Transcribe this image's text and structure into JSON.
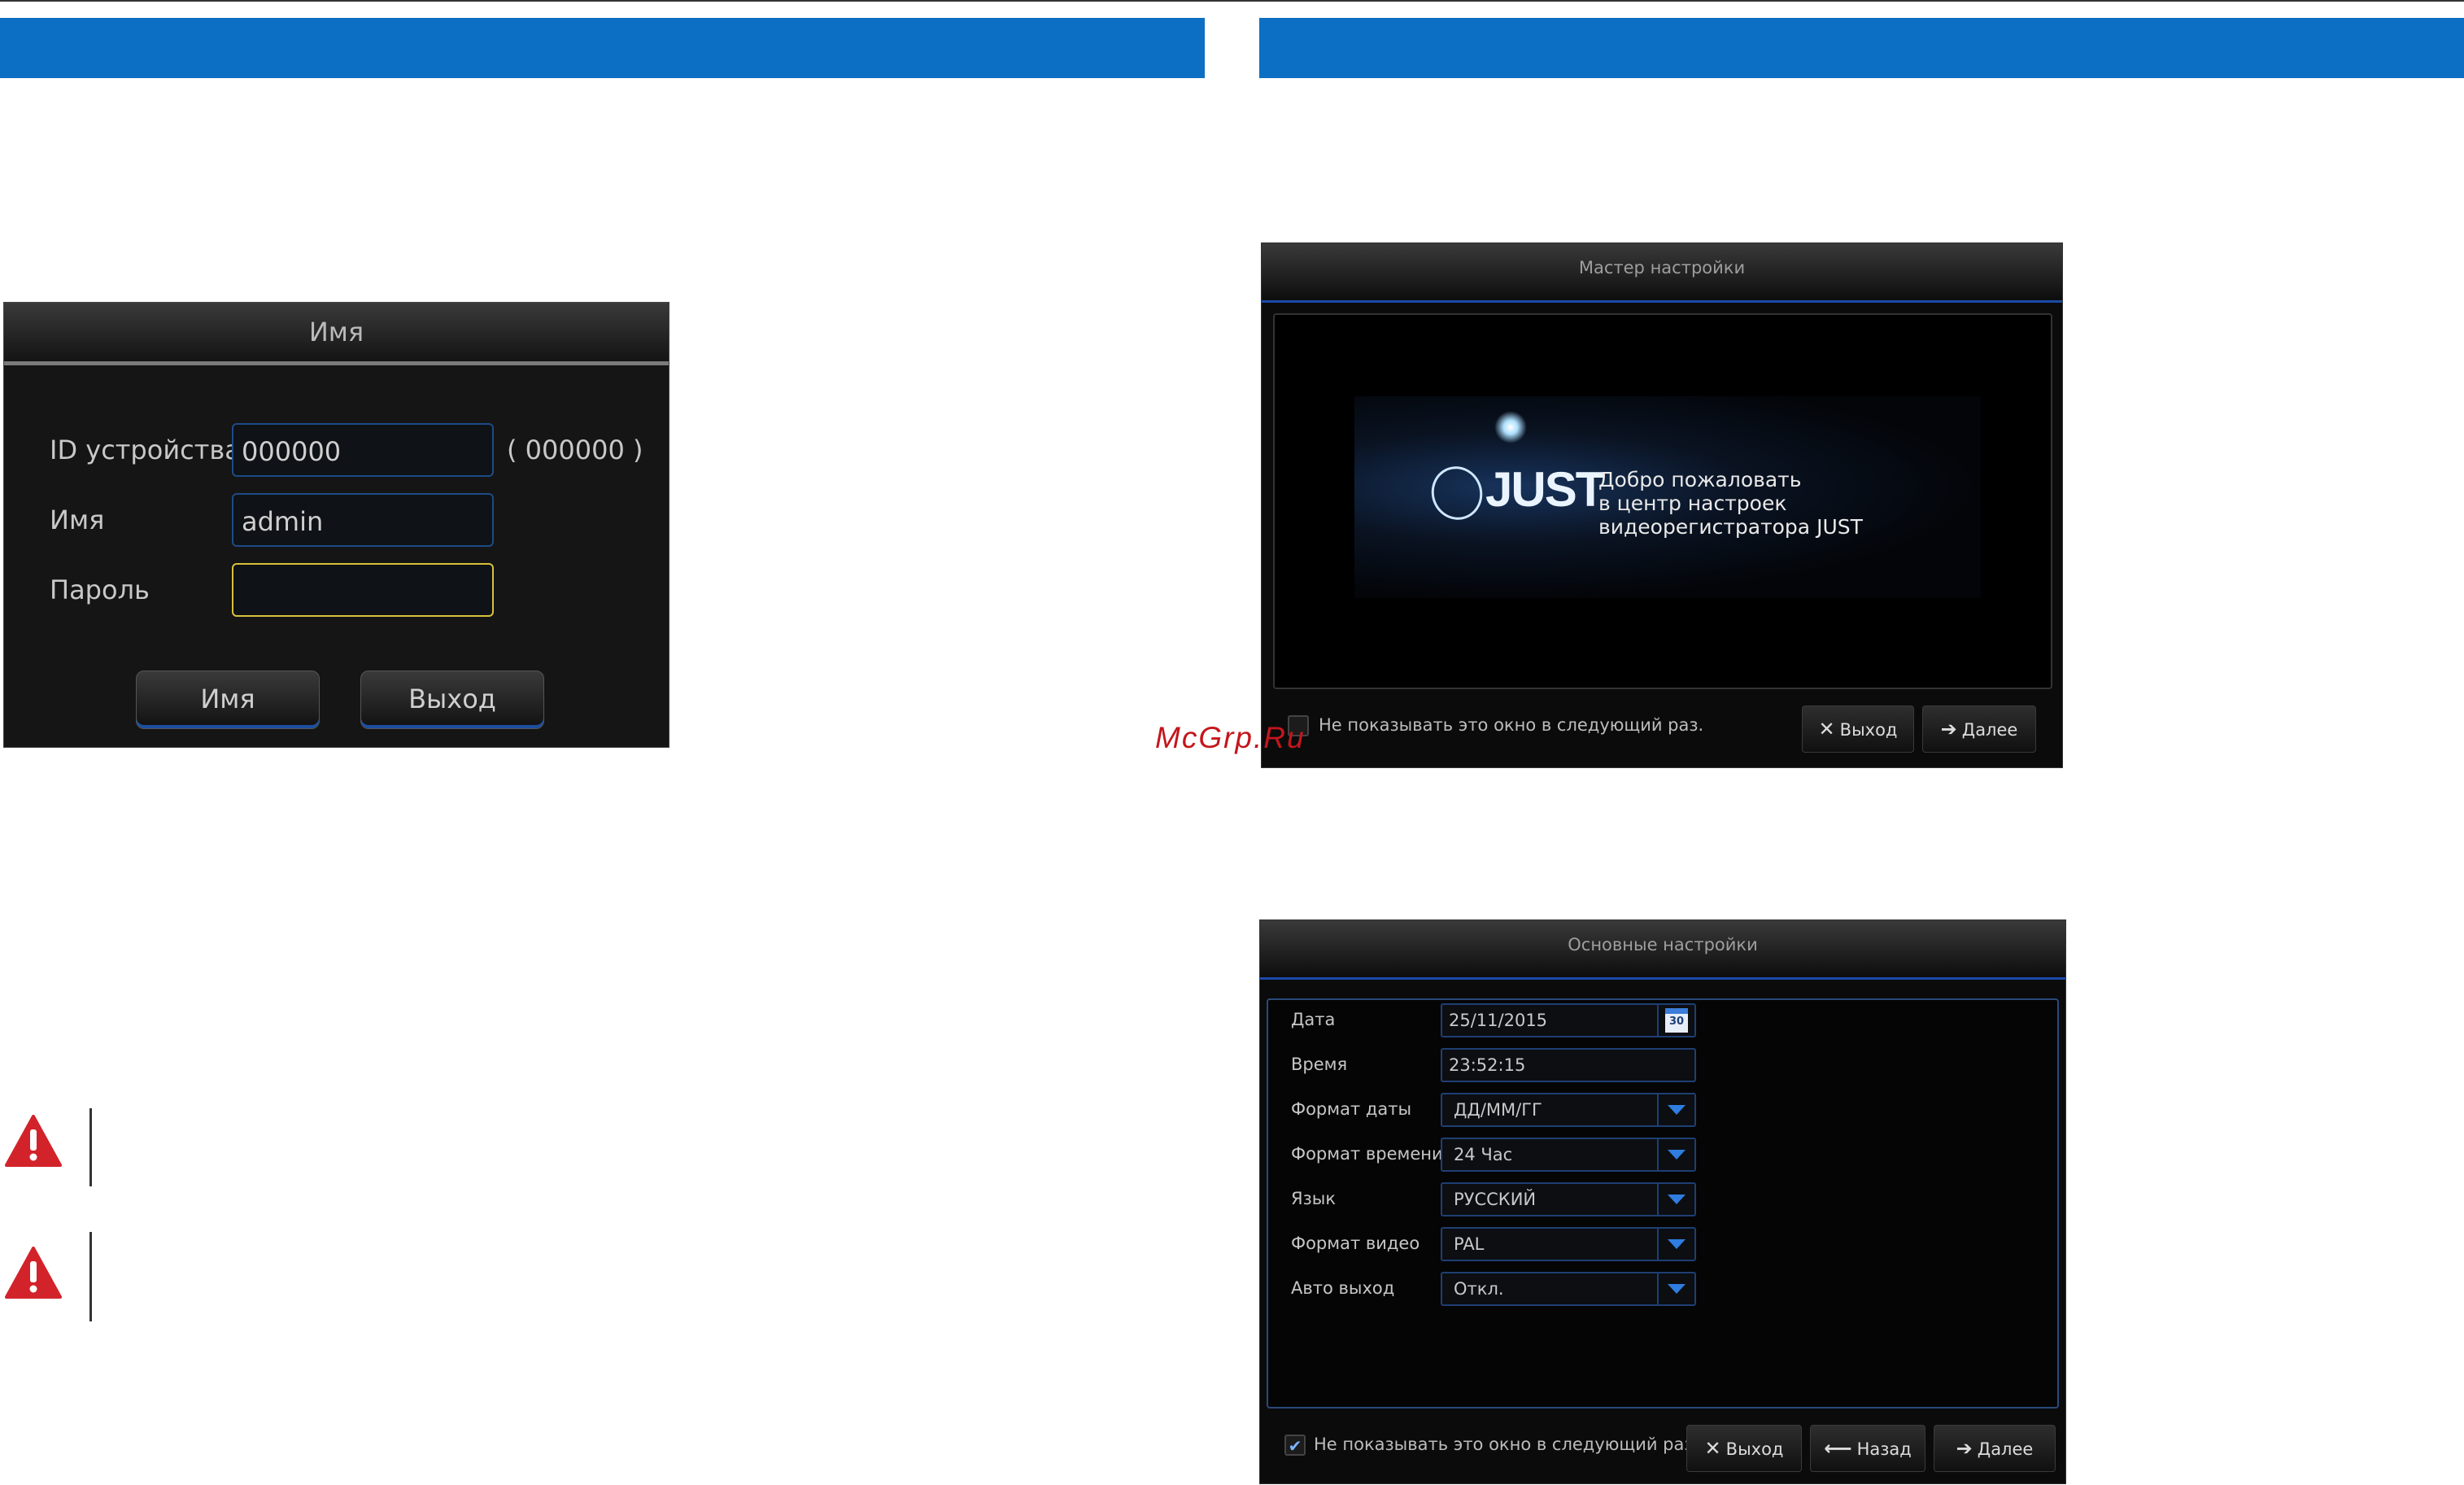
{
  "login": {
    "title": "Имя",
    "device_id_label": "ID устройства",
    "device_id_value": "000000",
    "device_id_hint": "( 000000 )",
    "name_label": "Имя",
    "name_value": "admin",
    "password_label": "Пароль",
    "password_value": "",
    "login_button": "Имя",
    "exit_button": "Выход"
  },
  "wizard": {
    "title": "Мастер настройки",
    "logo_text": "JUST",
    "welcome_line1": "Добро пожаловать",
    "welcome_line2": "в центр настроек",
    "welcome_line3": "видеорегистратора JUST",
    "dont_show_label": "Не показывать это окно в следующий раз.",
    "dont_show_checked": false,
    "exit_button": "Выход",
    "next_button": "Далее"
  },
  "settings": {
    "title": "Основные настройки",
    "rows": [
      {
        "label": "Дата",
        "value": "25/11/2015",
        "control": "calendar"
      },
      {
        "label": "Время",
        "value": "23:52:15",
        "control": "text"
      },
      {
        "label": "Формат даты",
        "value": "ДД/ММ/ГГ",
        "control": "dropdown"
      },
      {
        "label": "Формат времени",
        "value": "24 Час",
        "control": "dropdown"
      },
      {
        "label": "Язык",
        "value": "РУССКИЙ",
        "control": "dropdown"
      },
      {
        "label": "Формат видео",
        "value": "PAL",
        "control": "dropdown"
      },
      {
        "label": "Авто выход",
        "value": "Откл.",
        "control": "dropdown"
      }
    ],
    "calendar_day": "30",
    "dont_show_label": "Не показывать это окно в следующий раз.",
    "dont_show_checked": true,
    "exit_button": "Выход",
    "back_button": "Назад",
    "next_button": "Далее"
  },
  "watermark": "McGrp.Ru",
  "icons": {
    "warning": "warning-triangle-icon",
    "close": "close-x-icon",
    "arrow_right": "arrow-right-icon",
    "arrow_left": "arrow-left-icon",
    "calendar": "calendar-icon",
    "dropdown": "chevron-down-icon",
    "checkmark": "checkmark-icon"
  },
  "colors": {
    "header_blue": "#0d6fc3",
    "accent_blue": "#1b4aa8",
    "warning_red": "#c4161c",
    "active_field": "#d8c23a"
  }
}
